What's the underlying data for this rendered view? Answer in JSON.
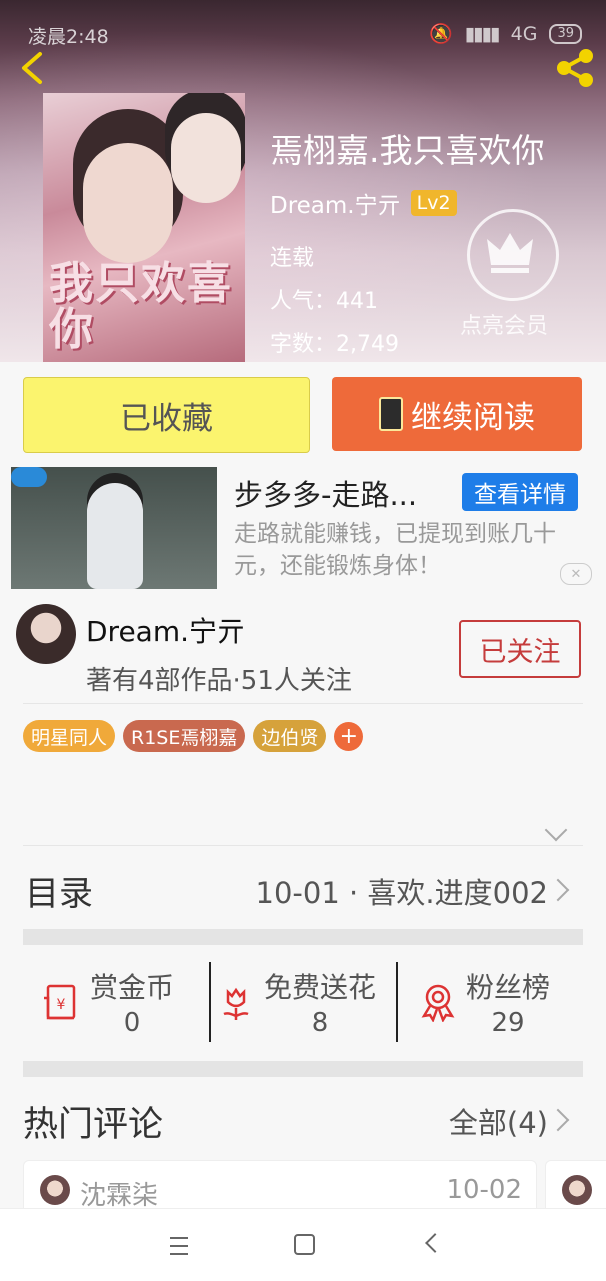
{
  "status_bar": {
    "time": "凌晨2:48",
    "network": "4G",
    "battery": "39"
  },
  "book": {
    "title": "焉栩嘉.我只喜欢你",
    "author": "Dream.宁亓",
    "author_level": "Lv2",
    "status": "连载",
    "popularity": "人气：441",
    "word_count": "字数：2,749",
    "cover_text": "我只欢喜你"
  },
  "vip": {
    "label": "点亮会员"
  },
  "actions": {
    "favorited_label": "已收藏",
    "continue_label": "继续阅读"
  },
  "ad": {
    "title": "步多多-走路...",
    "button_label": "查看详情",
    "description": "走路就能赚钱，已提现到账几十元，还能锻炼身体！",
    "close_label": "✕"
  },
  "author_card": {
    "name": "Dream.宁亓",
    "subtitle": "著有4部作品·51人关注",
    "follow_label": "已关注"
  },
  "tags": [
    {
      "label": "明星同人",
      "color": "#f0a93a"
    },
    {
      "label": "R1SE焉栩嘉",
      "color": "#c9694f"
    },
    {
      "label": "边伯贤",
      "color": "#d6a23b"
    }
  ],
  "tag_add": "+",
  "toc": {
    "label": "目录",
    "latest": "10-01 · 喜欢.进度002"
  },
  "stats": [
    {
      "label": "赏金币",
      "value": "0"
    },
    {
      "label": "免费送花",
      "value": "8"
    },
    {
      "label": "粉丝榜",
      "value": "29"
    }
  ],
  "comments": {
    "title": "热门评论",
    "all_label": "全部(4)",
    "items": [
      {
        "name": "沈霖柒",
        "date": "10-02"
      }
    ]
  },
  "colors": {
    "accent": "#ee6a3a",
    "favorite": "#fbf46e",
    "follow": "#c53c3c",
    "ad_button": "#1e7de8",
    "level_badge": "#f0b62c"
  }
}
